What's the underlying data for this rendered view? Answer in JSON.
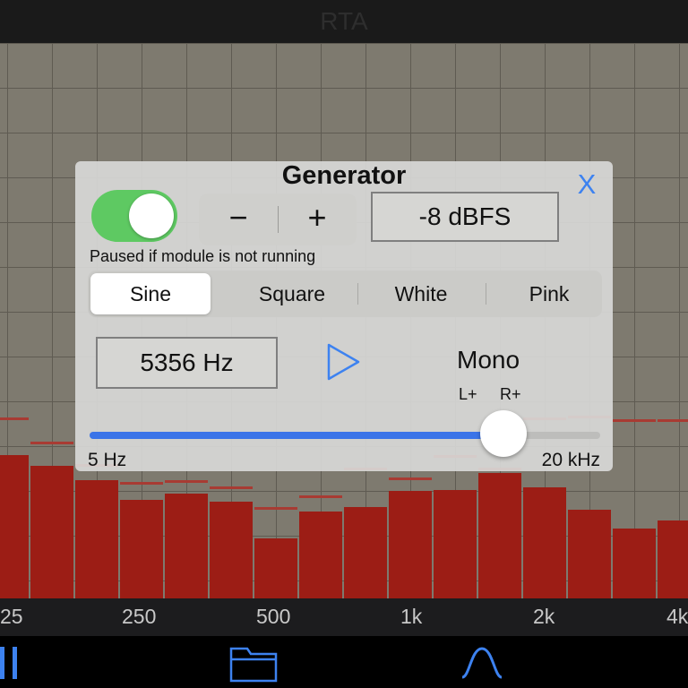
{
  "header": {
    "title": "RTA"
  },
  "spectrum": {
    "bar_color": "#9c1d15",
    "peak_color": "#a83b33",
    "background": "#7e7a6f"
  },
  "axis": {
    "ticks": [
      "25",
      "250",
      "500",
      "1k",
      "2k",
      "4k"
    ]
  },
  "toolbar": {
    "icons": [
      "pause-icon",
      "folder-icon",
      "sine-wave-icon"
    ]
  },
  "generator": {
    "title": "Generator",
    "close_label": "X",
    "enabled": true,
    "decrement_label": "−",
    "increment_label": "+",
    "level": "-8 dBFS",
    "note": "Paused if module is not running",
    "waveforms": [
      "Sine",
      "Square",
      "White",
      "Pink"
    ],
    "selected_waveform": "Sine",
    "frequency": "5356 Hz",
    "channel_mode": "Mono",
    "left_label": "L+",
    "right_label": "R+",
    "slider_min": "5 Hz",
    "slider_max": "20 kHz",
    "accent": "#3d82f0",
    "toggle_color": "#5ec962"
  }
}
